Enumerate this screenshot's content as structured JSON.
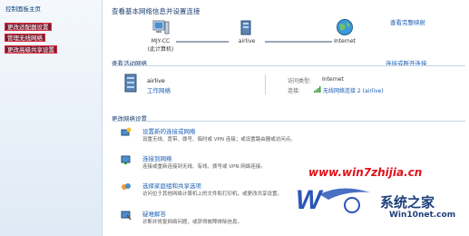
{
  "sidebar": {
    "title": "控制面板主页",
    "items": [
      {
        "label": "更改适配器设置"
      },
      {
        "label": "管理无线网络"
      },
      {
        "label": "更改高级共享设置"
      }
    ]
  },
  "header": {
    "title": "查看基本网络信息并设置连接",
    "full_map_link": "查看完整映射"
  },
  "map": {
    "computer_name": "MJY-CC",
    "computer_sub": "(此计算机)",
    "network": "airlive",
    "internet": "Internet"
  },
  "active": {
    "heading": "查看活动网络",
    "connect_link": "连接或断开连接",
    "name": "airlive",
    "type": "工作网络",
    "access_label": "访问类型:",
    "access_value": "Internet",
    "conn_label": "连接:",
    "conn_value": "无线网络连接 2 (airlive)"
  },
  "change": {
    "heading": "更改网络设置",
    "tasks": [
      {
        "title": "设置新的连接或网络",
        "desc": "设置无线、宽带、拨号、临时或 VPN 连接；或设置路由器或访问点。"
      },
      {
        "title": "连接到网络",
        "desc": "连接或重新连接到无线、有线、拨号或 VPN 网络连接。"
      },
      {
        "title": "选择家庭组和共享选项",
        "desc": "访问位于其他网络计算机上的文件和打印机，或更改共享设置。"
      },
      {
        "title": "疑难解答",
        "desc": "诊断并修复网络问题，或获得故障排除信息。"
      }
    ]
  },
  "watermark": {
    "url": "www.win7zhijia.cn",
    "brand": "系统之家",
    "site": "Win10net.com"
  },
  "colors": {
    "link": "#1a5fb4",
    "sidebar_highlight": "#7a1f34",
    "wm_red": "#e0101a"
  }
}
